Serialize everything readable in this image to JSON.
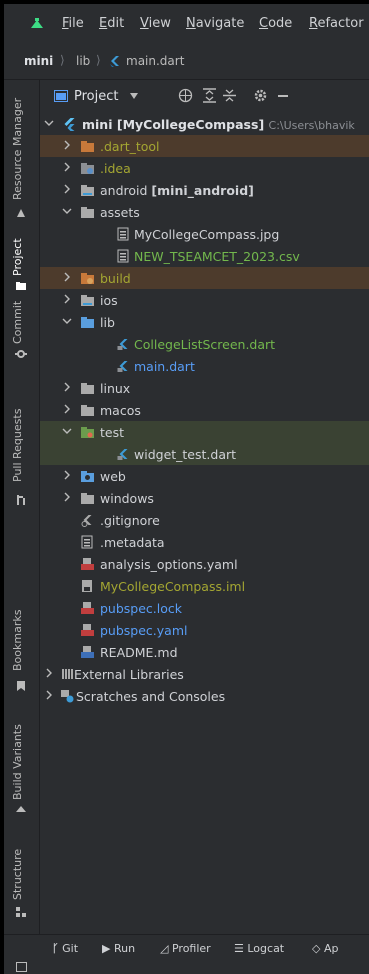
{
  "menu": [
    "File",
    "Edit",
    "View",
    "Navigate",
    "Code",
    "Refactor"
  ],
  "menu_mnemonic": [
    "F",
    "E",
    "V",
    "N",
    "C",
    "R"
  ],
  "menu_rest": [
    "ile",
    "dit",
    "iew",
    "avigate",
    "ode",
    "efactor"
  ],
  "breadcrumb": {
    "root": "mini",
    "folder": "lib",
    "file": "main.dart"
  },
  "tool_strip": {
    "resource_manager": "Resource Manager",
    "project": "Project",
    "commit": "Commit",
    "pull_requests": "Pull Requests",
    "bookmarks": "Bookmarks",
    "build_variants": "Build Variants",
    "structure": "Structure"
  },
  "panel": {
    "title": "Project"
  },
  "tree": {
    "root_name": "mini",
    "root_module": "[MyCollegeCompass]",
    "root_path": "C:\\Users\\bhavik",
    "dart_tool": ".dart_tool",
    "idea": ".idea",
    "android": "android",
    "android_module": "[mini_android]",
    "assets": "assets",
    "asset_jpg": "MyCollegeCompass.jpg",
    "asset_csv": "NEW_TSEAMCET_2023.csv",
    "build": "build",
    "ios": "ios",
    "lib": "lib",
    "college_list": "CollegeListScreen.dart",
    "main_dart": "main.dart",
    "linux": "linux",
    "macos": "macos",
    "test": "test",
    "widget_test": "widget_test.dart",
    "web": "web",
    "windows": "windows",
    "gitignore": ".gitignore",
    "metadata": ".metadata",
    "analysis_options": "analysis_options.yaml",
    "iml": "MyCollegeCompass.iml",
    "pubspec_lock": "pubspec.lock",
    "pubspec_yaml": "pubspec.yaml",
    "readme": "README.md",
    "external_libraries": "External Libraries",
    "scratches": "Scratches and Consoles"
  },
  "bottom": {
    "git": "Git",
    "run": "Run",
    "profiler": "Profiler",
    "logcat": "Logcat",
    "app": "Ap"
  },
  "colors": {
    "folder": "#aaaaaa",
    "excluded_folder": "#c8793a",
    "olive_text": "#a4a632",
    "green_text": "#73b84d",
    "blue_text": "#589df6",
    "flutter_blue": "#3d9bd6"
  }
}
